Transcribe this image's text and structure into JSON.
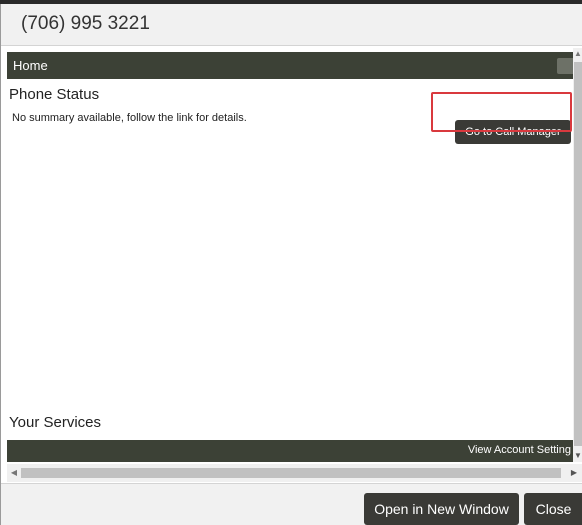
{
  "dialog": {
    "title": "(706) 995 3221"
  },
  "home_bar": {
    "label": "Home"
  },
  "phone_status": {
    "title": "Phone Status",
    "summary": "No summary available, follow the link for details.",
    "button_label": "Go to Call Manager"
  },
  "services": {
    "title": "Your Services",
    "settings_link": "View Account Setting"
  },
  "footer": {
    "open_new_window_label": "Open in New Window",
    "close_label": "Close"
  },
  "colors": {
    "header_bar": "#3c4136",
    "button": "#3a3a36",
    "highlight": "#d9393e"
  }
}
